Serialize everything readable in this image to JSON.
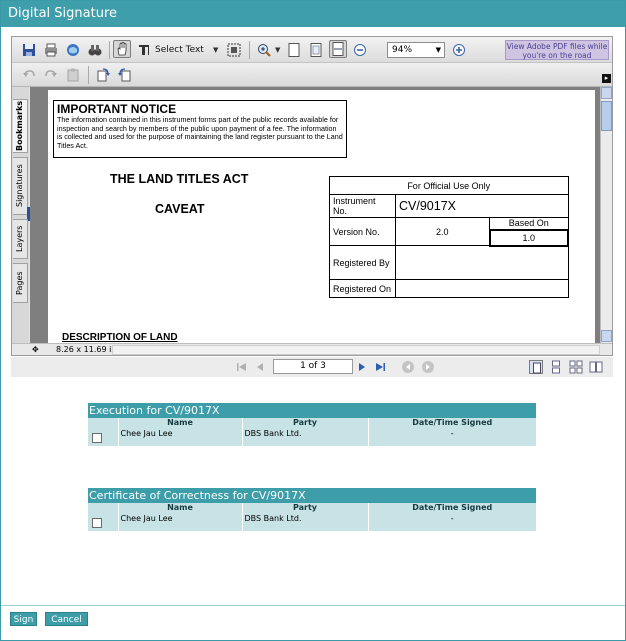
{
  "window": {
    "title": "Digital Signature"
  },
  "toolbar": {
    "select_text_label": "Select Text",
    "zoom_value": "94%",
    "ad_banner": "View Adobe PDF files while you're on the road"
  },
  "side_tabs": [
    "Bookmarks",
    "Signatures",
    "Layers",
    "Pages"
  ],
  "document": {
    "notice_title": "IMPORTANT NOTICE",
    "notice_body": "The information contained in this instrument forms part of the public records available for inspection and search by members of the public upon payment of a fee. The information is collected and used for the purpose of maintaining the land register pursuant to the Land Titles Act.",
    "act_title": "THE LAND TITLES ACT",
    "act_subtitle": "CAVEAT",
    "description_heading": "DESCRIPTION OF LAND",
    "official_use": {
      "header": "For Official Use Only",
      "instrument_label": "Instrument No.",
      "instrument_value": "CV/9017X",
      "version_label": "Version No.",
      "version_value": "2.0",
      "based_on_label": "Based On",
      "based_on_value": "1.0",
      "registered_by_label": "Registered By",
      "registered_on_label": "Registered On"
    }
  },
  "status": {
    "page_size": "8.26 x 11.69 in"
  },
  "navigation": {
    "page_indicator": "1 of 3"
  },
  "execution": {
    "title": "Execution for CV/9017X",
    "columns": [
      "Name",
      "Party",
      "Date/Time Signed"
    ],
    "rows": [
      {
        "name": "Chee Jau Lee",
        "party": "DBS Bank Ltd.",
        "date": "-"
      }
    ]
  },
  "certificate": {
    "title": "Certificate of Correctness for CV/9017X",
    "columns": [
      "Name",
      "Party",
      "Date/Time Signed"
    ],
    "rows": [
      {
        "name": "Chee Jau Lee",
        "party": "DBS Bank Ltd.",
        "date": "-"
      }
    ]
  },
  "actions": {
    "sign_label": "Sign",
    "cancel_label": "Cancel"
  },
  "colors": {
    "accent": "#3e9fab",
    "table_row": "#c7e3e6"
  }
}
